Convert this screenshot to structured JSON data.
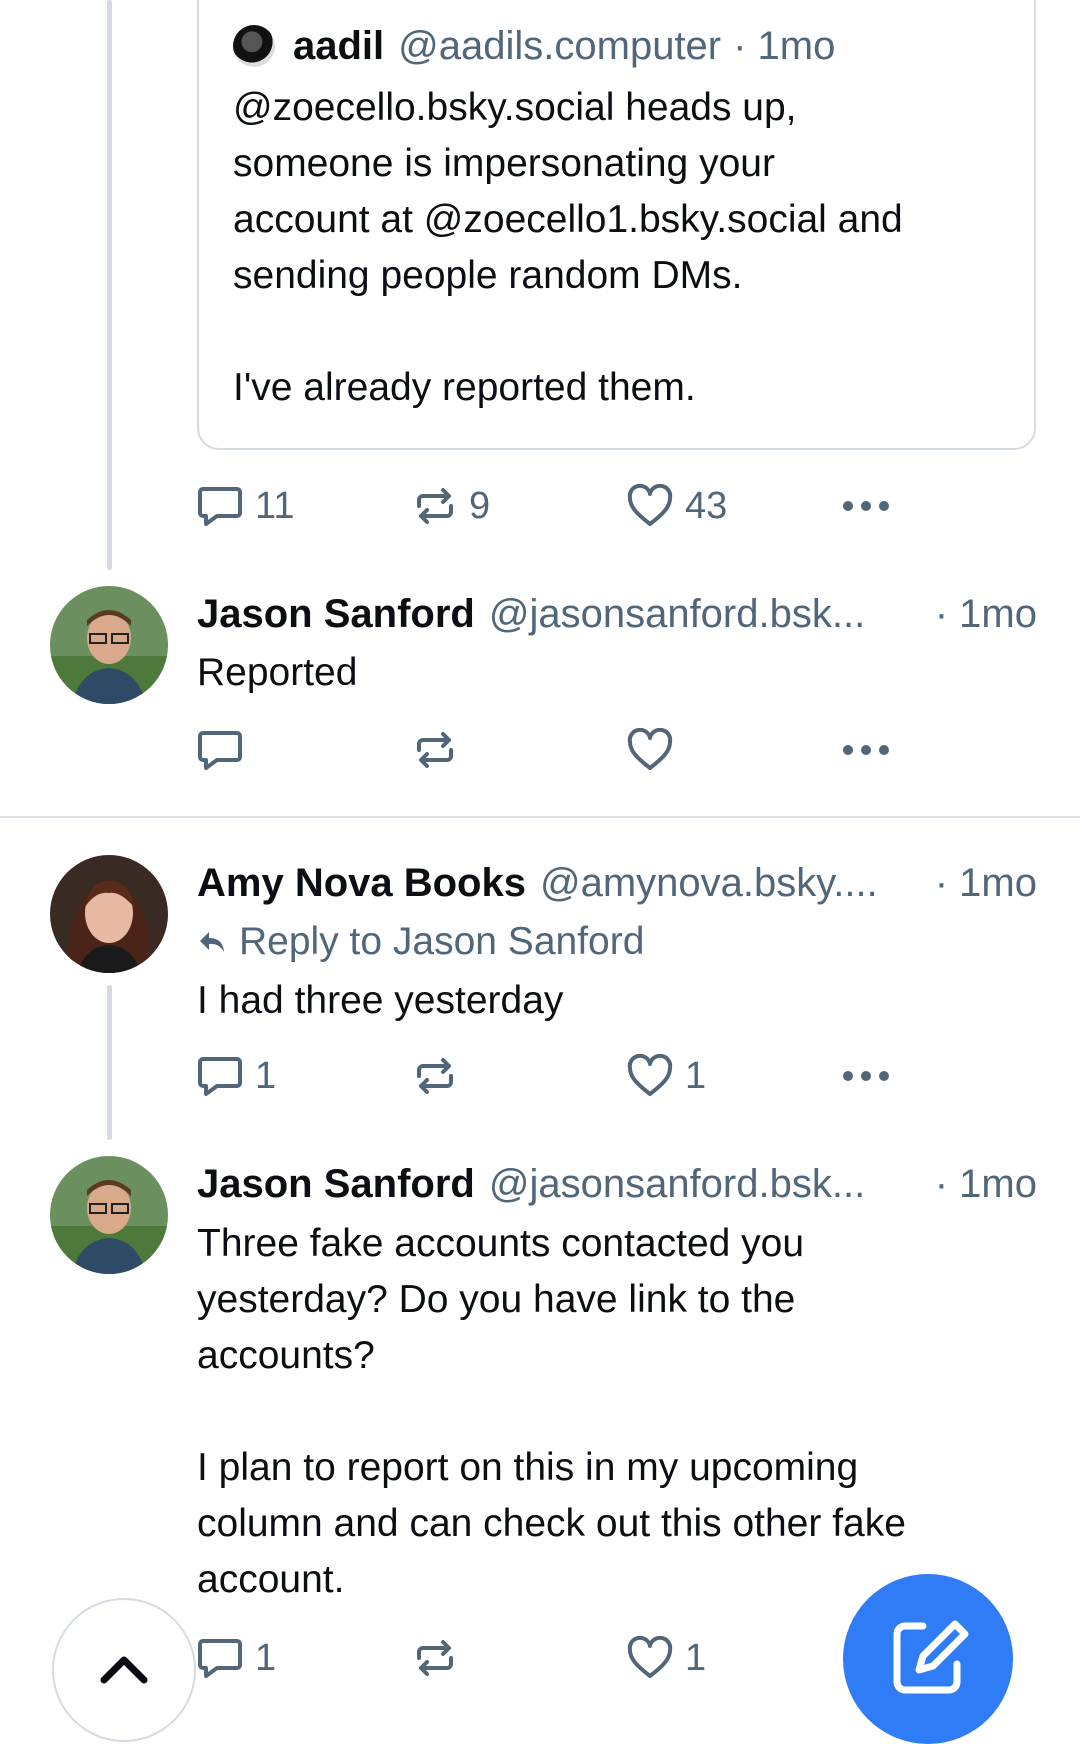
{
  "quoted_post": {
    "author_name": "aadil",
    "author_handle": "@aadils.computer",
    "time": "· 1mo",
    "text": "@zoecello.bsky.social heads up,\nsomeone is impersonating your\naccount at @zoecello1.bsky.social and\nsending people random DMs.\n\nI've already reported them."
  },
  "first_post_actions": {
    "replies": "11",
    "reposts": "9",
    "likes": "43"
  },
  "posts": [
    {
      "author_name": "Jason Sanford",
      "author_handle": "@jasonsanford.bsk...",
      "time": "· 1mo",
      "text": "Reported",
      "replies": "",
      "reposts": "",
      "likes": ""
    },
    {
      "author_name": "Amy Nova Books",
      "author_handle": "@amynova.bsky....",
      "time": "· 1mo",
      "reply_to": "Reply to Jason Sanford",
      "text": "I had three yesterday",
      "replies": "1",
      "reposts": "",
      "likes": "1"
    },
    {
      "author_name": "Jason Sanford",
      "author_handle": "@jasonsanford.bsk...",
      "time": "· 1mo",
      "text": "Three fake accounts contacted you\nyesterday? Do you have link to the\naccounts?\n\nI plan to report on this in my upcoming\ncolumn and can check out this other fake\naccount.",
      "replies": "1",
      "reposts": "",
      "likes": "1"
    }
  ],
  "icons": {
    "reply": "reply-icon",
    "repost": "repost-icon",
    "like": "heart-icon",
    "more": "more-icon",
    "scroll_top": "chevron-up-icon",
    "compose": "compose-icon"
  },
  "colors": {
    "accent": "#2f7cf6",
    "muted": "#52667a",
    "border": "#d4dbe2"
  }
}
